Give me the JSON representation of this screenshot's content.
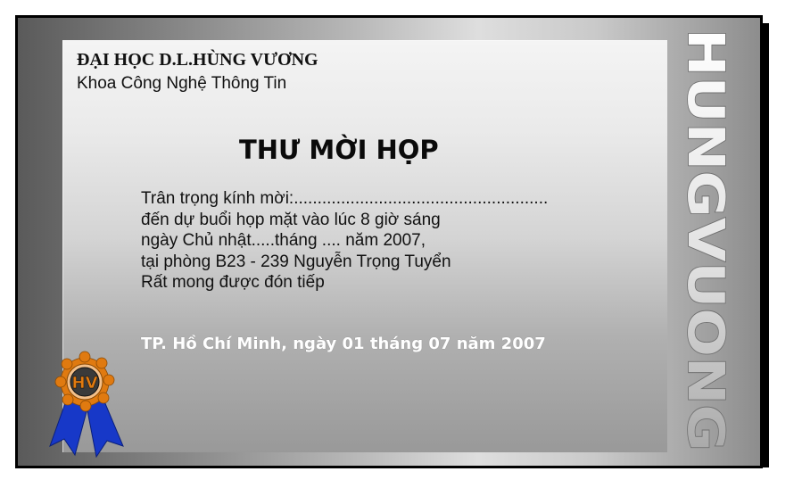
{
  "document": {
    "university": "ĐẠI HỌC D.L.HÙNG VƯƠNG",
    "faculty": "Khoa Công Nghệ Thông Tin",
    "title": "THƯ MỜI HỌP",
    "body_lines": [
      "Trân trọng kính mời:......................................................",
      "đến dự buổi họp mặt vào lúc 8 giờ sáng",
      "ngày Chủ nhật.....tháng .... năm 2007,",
      "tại phòng B23 - 239 Nguyễn Trọng Tuyển",
      "Rất mong được đón tiếp"
    ],
    "date_line": "TP. Hồ Chí Minh, ngày 01 tháng 07 năm 2007",
    "vertical_brand": "HUNGVUONG",
    "seal_text": "HV"
  },
  "colors": {
    "card_border": "#000000",
    "brand_text_fill": "#e6e6e6",
    "seal_ring": "#e07a10",
    "seal_inner": "#3a3a3a",
    "ribbon": "#1738c8",
    "date_text": "#ffffff"
  },
  "icons": {
    "seal": "award-ribbon-icon"
  }
}
